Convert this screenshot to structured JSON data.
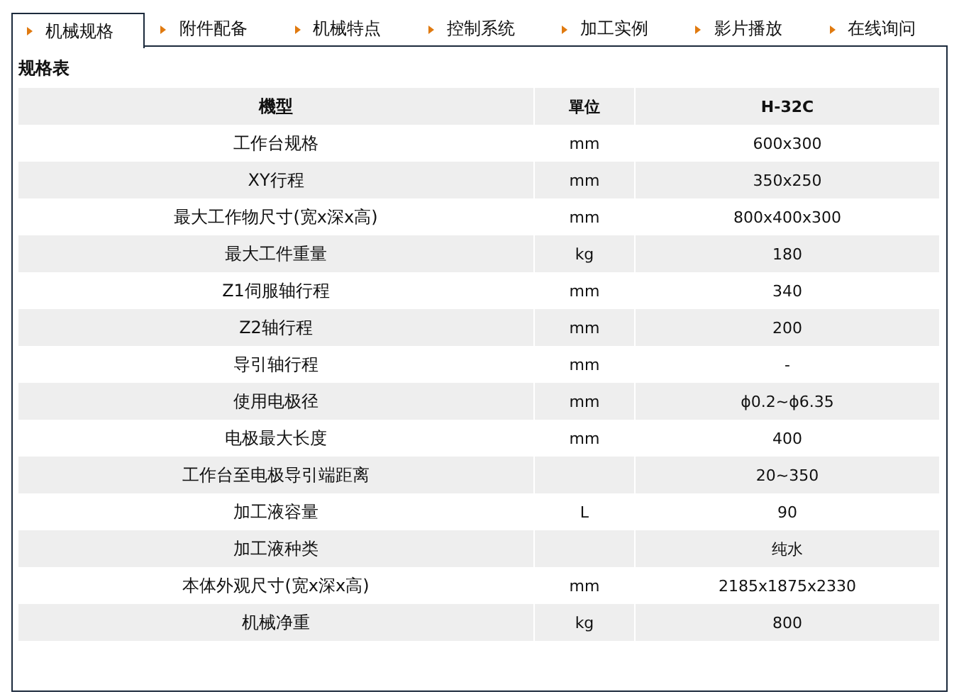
{
  "tabs": [
    {
      "label": "机械规格",
      "selected": true
    },
    {
      "label": "附件配备",
      "selected": false
    },
    {
      "label": "机械特点",
      "selected": false
    },
    {
      "label": "控制系统",
      "selected": false
    },
    {
      "label": "加工实例",
      "selected": false
    },
    {
      "label": "影片播放",
      "selected": false
    },
    {
      "label": "在线询问",
      "selected": false
    }
  ],
  "section_title": "规格表",
  "table": {
    "columns": [
      "機型",
      "單位",
      "H-32C"
    ],
    "rows": [
      [
        "工作台规格",
        "mm",
        "600x300"
      ],
      [
        "XY行程",
        "mm",
        "350x250"
      ],
      [
        "最大工作物尺寸(宽x深x高)",
        "mm",
        "800x400x300"
      ],
      [
        "最大工件重量",
        "kg",
        "180"
      ],
      [
        "Z1伺服轴行程",
        "mm",
        "340"
      ],
      [
        "Z2轴行程",
        "mm",
        "200"
      ],
      [
        "导引轴行程",
        "mm",
        "-"
      ],
      [
        "使用电极径",
        "mm",
        "ϕ0.2~ϕ6.35"
      ],
      [
        "电极最大长度",
        "mm",
        "400"
      ],
      [
        "工作台至电极导引端距离",
        "",
        "20~350"
      ],
      [
        "加工液容量",
        "L",
        "90"
      ],
      [
        "加工液种类",
        "",
        "纯水"
      ],
      [
        "本体外观尺寸(宽x深x高)",
        "mm",
        "2185x1875x2330"
      ],
      [
        "机械净重",
        "kg",
        "800"
      ]
    ]
  }
}
